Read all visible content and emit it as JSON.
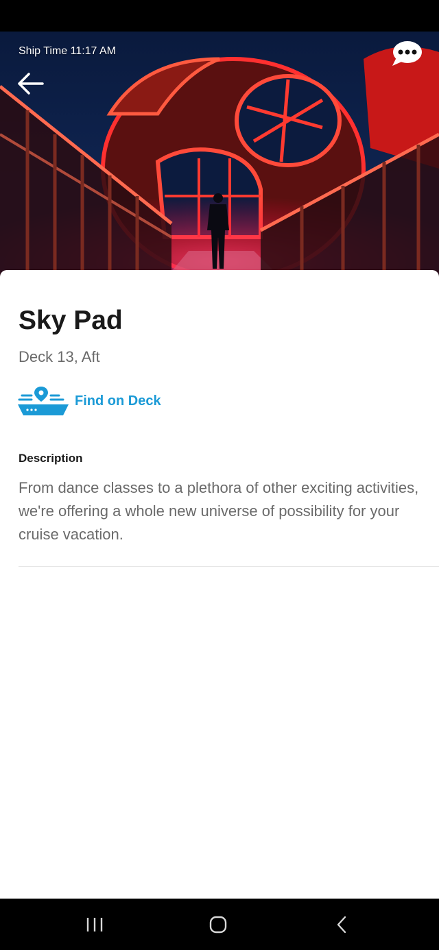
{
  "header": {
    "ship_time": "Ship Time 11:17 AM",
    "back_icon": "arrow-left-icon",
    "chat_icon": "chat-bubble-icon"
  },
  "venue": {
    "name": "Sky Pad",
    "location": "Deck 13, Aft",
    "find_on_deck_label": "Find on Deck",
    "find_icon": "ship-location-icon"
  },
  "description": {
    "heading": "Description",
    "text": "From dance classes to a plethora of other exciting activities, we're offering a whole new universe of possibility for your cruise vacation."
  },
  "nav": {
    "recents_icon": "recent-apps-icon",
    "home_icon": "home-icon",
    "back_icon": "back-chevron-icon"
  },
  "colors": {
    "accent": "#1b9ad6",
    "title": "#1a1a1a",
    "secondary_text": "#6a6a6a",
    "neon": "#ff2a2a"
  }
}
